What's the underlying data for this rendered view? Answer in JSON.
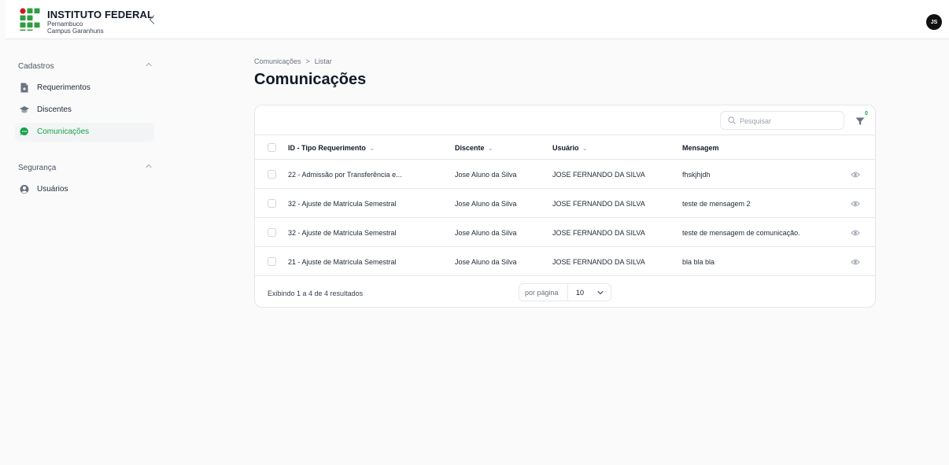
{
  "brand": {
    "title": "INSTITUTO FEDERAL",
    "subtitle1": "Pernambuco",
    "subtitle2": "Campus Garanhuns",
    "colors": {
      "green": "#2f9e41",
      "red": "#cd191e"
    }
  },
  "header": {
    "avatar_initials": "JS",
    "collapse_icon": "chevron-left-icon"
  },
  "sidebar": {
    "groups": [
      {
        "label": "Cadastros",
        "items": [
          {
            "label": "Requerimentos",
            "icon": "document-icon"
          },
          {
            "label": "Discentes",
            "icon": "graduation-cap-icon"
          },
          {
            "label": "Comunicações",
            "icon": "chat-bubble-icon",
            "active": true
          }
        ]
      },
      {
        "label": "Segurança",
        "items": [
          {
            "label": "Usuários",
            "icon": "user-circle-icon"
          }
        ]
      }
    ]
  },
  "breadcrumb": {
    "items": [
      "Comunicações",
      "Listar"
    ],
    "separator": ">"
  },
  "page": {
    "title": "Comunicações"
  },
  "table": {
    "search": {
      "placeholder": "Pesquisar",
      "value": ""
    },
    "filter": {
      "badge_count": "0"
    },
    "columns": [
      "ID - Tipo Requerimento",
      "Discente",
      "Usuário",
      "Mensagem"
    ],
    "rows": [
      [
        "22 - Admissão por Transferência e...",
        "Jose Aluno da Silva",
        "JOSE FERNANDO DA SILVA",
        "fhskjhjdh"
      ],
      [
        "32 - Ajuste de Matrícula Semestral",
        "Jose Aluno da Silva",
        "JOSE FERNANDO DA SILVA",
        "teste de mensagem 2"
      ],
      [
        "32 - Ajuste de Matrícula Semestral",
        "Jose Aluno da Silva",
        "JOSE FERNANDO DA SILVA",
        "teste de mensagem de comunicação."
      ],
      [
        "21 - Ajuste de Matrícula Semestral",
        "Jose Aluno da Silva",
        "JOSE FERNANDO DA SILVA",
        "bla bla bla"
      ]
    ],
    "footer": {
      "info": "Exibindo 1 a 4 de 4 resultados",
      "per_page_label": "por página",
      "per_page_value": "10"
    }
  },
  "colors": {
    "accent": "#16a34a",
    "border": "#e5e7eb",
    "muted": "#6b7280"
  }
}
